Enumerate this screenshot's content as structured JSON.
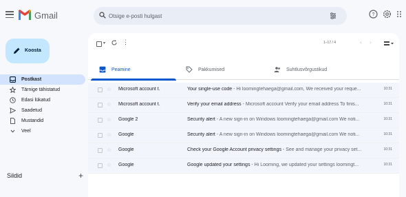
{
  "app": {
    "name": "Gmail"
  },
  "search": {
    "placeholder": "Otsige e-posti hulgast"
  },
  "compose": {
    "label": "Koosta"
  },
  "nav": [
    {
      "label": "Postkast",
      "icon": "inbox-icon",
      "active": true
    },
    {
      "label": "Tärnige tähistatud",
      "icon": "star-icon",
      "active": false
    },
    {
      "label": "Edasi lükatud",
      "icon": "clock-icon",
      "active": false
    },
    {
      "label": "Saadetud",
      "icon": "send-icon",
      "active": false
    },
    {
      "label": "Mustandid",
      "icon": "draft-icon",
      "active": false
    },
    {
      "label": "Veel",
      "icon": "chevron-down-icon",
      "active": false
    }
  ],
  "labels_heading": "Sildid",
  "labels_add": "+",
  "toolbar": {
    "pager_text": "1–17 / 4"
  },
  "tabs": [
    {
      "label": "Peamine",
      "icon": "inbox-icon",
      "active": true
    },
    {
      "label": "Pakkumised",
      "icon": "tag-icon",
      "active": false
    },
    {
      "label": "Suhtlusvõrgustikud",
      "icon": "people-icon",
      "active": false
    }
  ],
  "emails": [
    {
      "sender": "Microsoft account t.",
      "subject": "Your single-use code",
      "snippet": " - Hi loomingtehaega@gmail.com, We received your reque...",
      "time": "10:31"
    },
    {
      "sender": "Microsoft account t.",
      "subject": "Verify your email address",
      "snippet": " - Microsoft account Verify your email address To finis...",
      "time": "10:31"
    },
    {
      "sender": "Google 2",
      "subject": "Security alert",
      "snippet": " - A new sign-in on Windows loomingtehaega@gmail.com We noti...",
      "time": "10:31"
    },
    {
      "sender": "Google",
      "subject": "Security alert",
      "snippet": " - A new sign-in on Windows loomingtehaega@gmail.com We noti...",
      "time": "10:31"
    },
    {
      "sender": "Google",
      "subject": "Check your Google Account privacy settings",
      "snippet": " - See and manage your privacy set...",
      "time": "10:31"
    },
    {
      "sender": "Google",
      "subject": "Google updated your settings",
      "snippet": " - Hi Looming, we updated your settings loomingt...",
      "time": "10:31"
    }
  ],
  "colors": {
    "accent": "#0b57d0",
    "compose_bg": "#c2e7ff",
    "active_nav": "#d3e3fd",
    "logo_red": "#ea4335"
  }
}
